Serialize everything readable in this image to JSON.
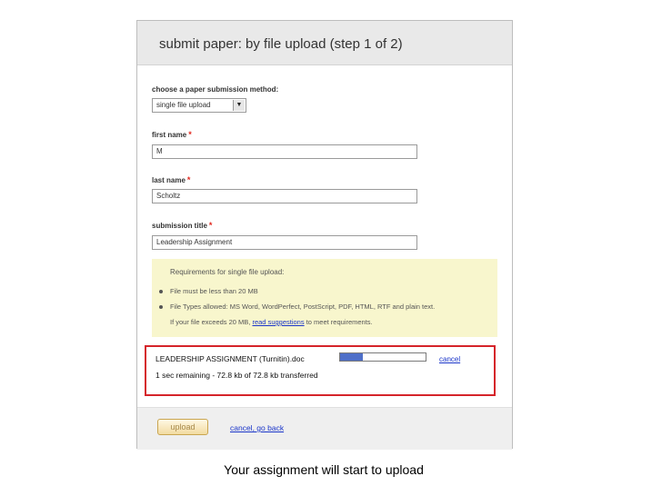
{
  "header": {
    "title": "submit paper: by file upload (step 1 of 2)"
  },
  "method": {
    "label": "choose a paper submission method:",
    "selected": "single file upload",
    "icon": "chevron-down-icon"
  },
  "first_name": {
    "label": "first name",
    "required_mark": "*",
    "value": "M"
  },
  "last_name": {
    "label": "last name",
    "required_mark": "*",
    "value": "Scholtz"
  },
  "submission_title": {
    "label": "submission title",
    "required_mark": "*",
    "value": "Leadership Assignment"
  },
  "requirements": {
    "heading": "Requirements for single file upload:",
    "items": [
      "File must be less than 20 MB",
      "File Types allowed: MS Word, WordPerfect, PostScript, PDF, HTML, RTF and plain text."
    ],
    "note_prefix": "If your file exceeds 20 MB,",
    "note_link": "read suggestions",
    "note_suffix": "to meet requirements."
  },
  "upload": {
    "file_name": "LEADERSHIP ASSIGNMENT (Turnitin).doc",
    "progress_fraction": 0.27,
    "cancel_label": "cancel",
    "status": "1 sec remaining - 72.8 kb of 72.8 kb transferred"
  },
  "actions": {
    "upload_label": "upload",
    "cancel_back_label": "cancel, go back"
  },
  "caption": "Your assignment will start to upload",
  "colors": {
    "required": "#e1261c",
    "highlight_border": "#d5242a",
    "progress": "#4e6fc8",
    "link": "#1a35c9",
    "requirements_bg": "#f8f6cd"
  }
}
